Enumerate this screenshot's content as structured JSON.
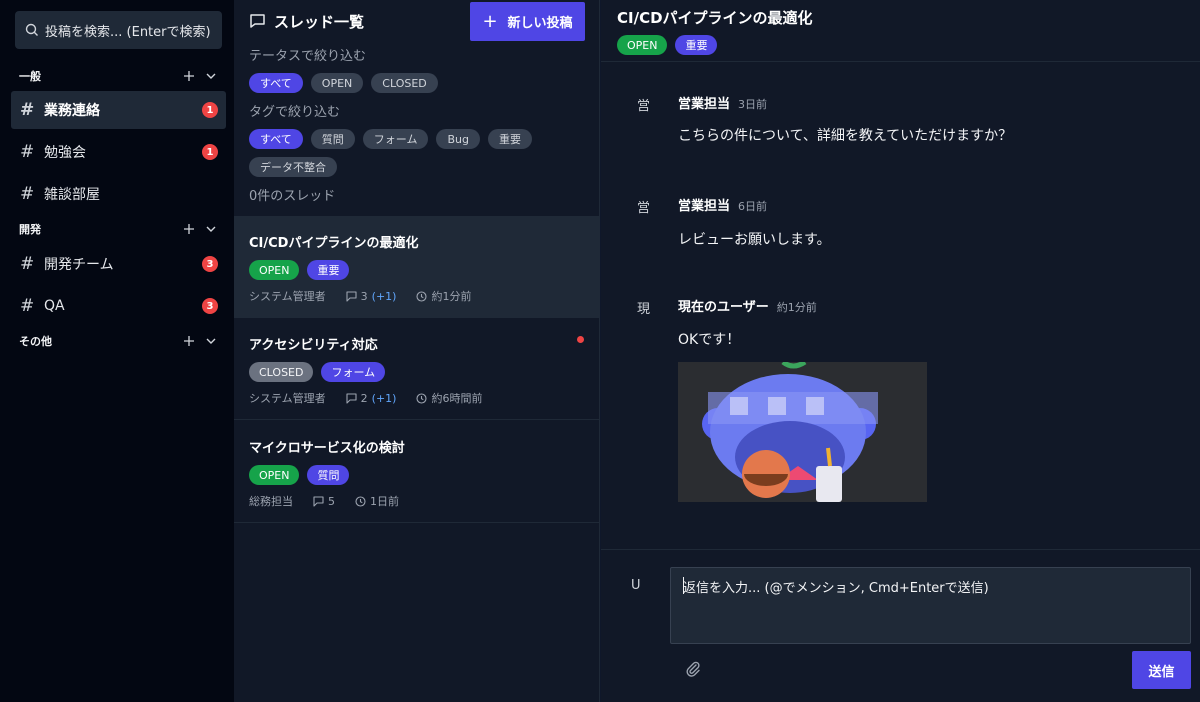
{
  "search": {
    "placeholder": "投稿を検索... (Enterで検索)"
  },
  "sidebar": {
    "sections": [
      {
        "title": "一般",
        "channels": [
          {
            "label": "業務連絡",
            "badge": "1",
            "active": true
          },
          {
            "label": "勉強会",
            "badge": "1"
          },
          {
            "label": "雑談部屋",
            "badge": ""
          }
        ]
      },
      {
        "title": "開発",
        "channels": [
          {
            "label": "開発チーム",
            "badge": "3"
          },
          {
            "label": "QA",
            "badge": "3"
          }
        ]
      },
      {
        "title": "その他",
        "channels": []
      }
    ],
    "hash": "#",
    "plus": "+"
  },
  "thread_list": {
    "title": "スレッド一覧",
    "new_button": "新しい投稿",
    "new_button_icon": "+",
    "status_filter_label": "テータスで絞り込む",
    "status_filters": [
      "すべて",
      "OPEN",
      "CLOSED"
    ],
    "tag_filter_label": "タグで絞り込む",
    "tag_filters": [
      "すべて",
      "質問",
      "フォーム",
      "Bug",
      "重要",
      "データ不整合"
    ],
    "count": "0件のスレッド",
    "threads": [
      {
        "title": "CI/CDパイプラインの最適化",
        "status": "OPEN",
        "tag": "重要",
        "author": "システム管理者",
        "replies": "3",
        "new_replies": "(+1)",
        "time": "約1分前",
        "selected": true,
        "unread": false
      },
      {
        "title": "アクセシビリティ対応",
        "status": "CLOSED",
        "tag": "フォーム",
        "author": "システム管理者",
        "replies": "2",
        "new_replies": "(+1)",
        "time": "約6時間前",
        "selected": false,
        "unread": true
      },
      {
        "title": "マイクロサービス化の検討",
        "status": "OPEN",
        "tag": "質問",
        "author": "総務担当",
        "replies": "5",
        "new_replies": "",
        "time": "1日前",
        "selected": false,
        "unread": false
      }
    ]
  },
  "detail": {
    "title": "CI/CDパイプラインの最適化",
    "status": "OPEN",
    "tag": "重要",
    "messages": [
      {
        "avatar": "営",
        "author": "営業担当",
        "time": "3日前",
        "text": "こちらの件について、詳細を教えていただけますか？"
      },
      {
        "avatar": "営",
        "author": "営業担当",
        "time": "6日前",
        "text": "レビューお願いします。"
      },
      {
        "avatar": "現",
        "author": "現在のユーザー",
        "time": "約1分前",
        "text": "OKです！"
      }
    ]
  },
  "composer": {
    "avatar": "U",
    "placeholder": "返信を入力... (@でメンション, Cmd+Enterで送信)",
    "send_label": "送信"
  },
  "colors": {
    "accent": "#4f46e5",
    "open": "#16a34a",
    "closed": "#6b7280",
    "badge": "#ef4444",
    "link": "#60a5fa"
  }
}
